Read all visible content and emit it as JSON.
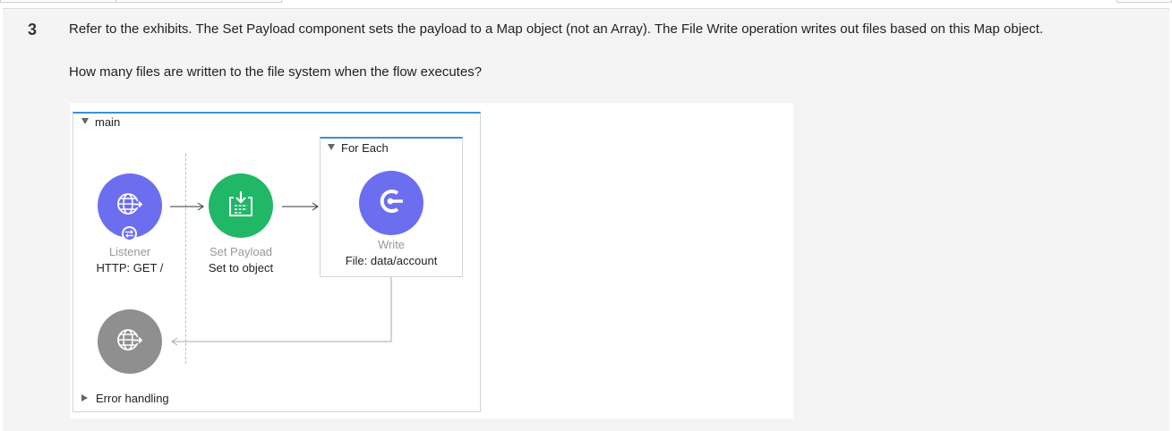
{
  "question": {
    "number": "3",
    "text": "Refer to the exhibits. The Set Payload component sets the payload to a Map object (not an Array). The File Write operation writes out files based on this Map object.",
    "prompt": "How many files are written to the file system when the flow executes?"
  },
  "flow": {
    "name": "main",
    "listener": {
      "type_label": "Listener",
      "detail": "HTTP: GET /",
      "color": "#6c6ef0",
      "icon": "globe-icon"
    },
    "set_payload": {
      "type_label": "Set Payload",
      "detail": "Set to object",
      "color": "#20b866",
      "icon": "set-payload-icon"
    },
    "for_each": {
      "name": "For Each",
      "write": {
        "type_label": "Write",
        "detail": "File: data/account",
        "color": "#6c6ef0",
        "icon": "file-connector-icon"
      }
    },
    "response_icon": {
      "color": "#8f8f8f",
      "icon": "globe-icon"
    },
    "error_handling": "Error handling"
  }
}
